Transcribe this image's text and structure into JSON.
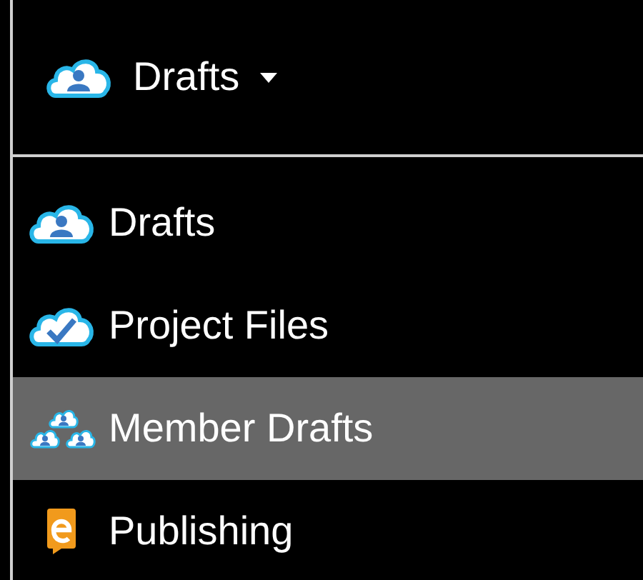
{
  "header": {
    "label": "Drafts",
    "kind": "person",
    "expanded": true
  },
  "menu": [
    {
      "label": "Drafts",
      "kind": "person",
      "selected": false
    },
    {
      "label": "Project Files",
      "kind": "check",
      "selected": false
    },
    {
      "label": "Member Drafts",
      "kind": "group",
      "selected": true
    },
    {
      "label": "Publishing",
      "kind": "publish",
      "selected": false
    }
  ]
}
